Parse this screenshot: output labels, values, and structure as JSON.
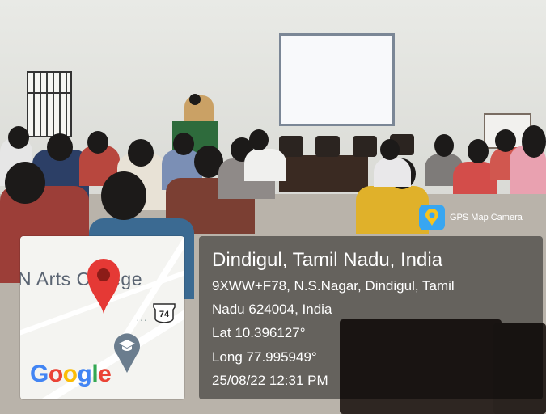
{
  "map": {
    "place_label": "N Arts College",
    "route_number": "74",
    "logo_text": "Google",
    "pin_icon": "location-pin-icon",
    "poi_icon": "graduation-cap-icon"
  },
  "app": {
    "name": "GPS Map Camera",
    "icon": "map-pin-camera-icon"
  },
  "location": {
    "title": "Dindigul, Tamil Nadu, India",
    "address_line1": "9XWW+F78, N.S.Nagar, Dindigul, Tamil",
    "address_line2": "Nadu 624004, India",
    "latitude": "Lat 10.396127°",
    "longitude": "Long 77.995949°",
    "datetime": "25/08/22 12:31 PM"
  },
  "colors": {
    "pin": "#E53935",
    "overlay": "#000000",
    "app_icon_bg": "#38A6F1"
  }
}
